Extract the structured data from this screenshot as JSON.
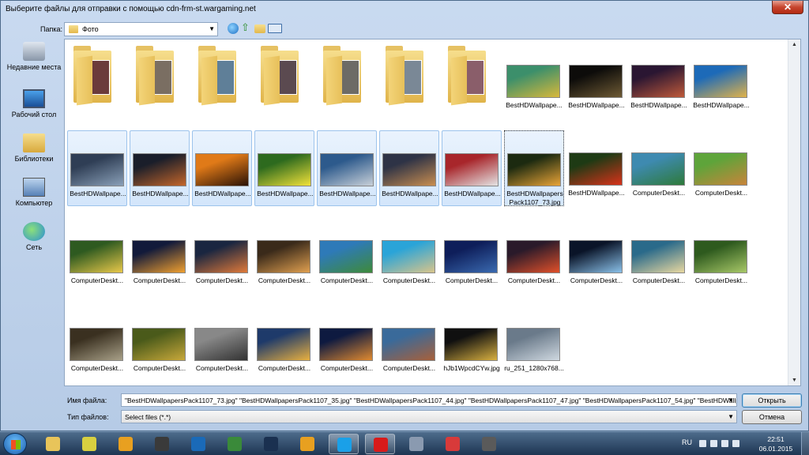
{
  "window": {
    "title": "Выберите файлы для отправки с помощью cdn-frm-st.wargaming.net",
    "close_label": "✕"
  },
  "toolbar": {
    "folder_label": "Папка:",
    "folder_value": "Фото"
  },
  "places": [
    {
      "label": "Недавние места",
      "icon": "recent-places-icon"
    },
    {
      "label": "Рабочий стол",
      "icon": "desktop-icon"
    },
    {
      "label": "Библиотеки",
      "icon": "libraries-icon"
    },
    {
      "label": "Компьютер",
      "icon": "computer-icon"
    },
    {
      "label": "Сеть",
      "icon": "network-icon"
    }
  ],
  "folders": [
    {
      "thumb_color": "#6b3b3b"
    },
    {
      "thumb_color": "#7a6e62"
    },
    {
      "thumb_color": "#5f7f98"
    },
    {
      "thumb_color": "#5b4a50"
    },
    {
      "thumb_color": "#6d6b66"
    },
    {
      "thumb_color": "#7a8896"
    },
    {
      "thumb_color": "#8a5e6a"
    }
  ],
  "files": [
    {
      "name": "BestHDWallpape...",
      "colors": [
        "#3c8f6b",
        "#d8b83b"
      ],
      "selected": false
    },
    {
      "name": "BestHDWallpape...",
      "colors": [
        "#0d0c0a",
        "#6e5a34"
      ],
      "selected": false
    },
    {
      "name": "BestHDWallpape...",
      "colors": [
        "#2a1632",
        "#c05a3a"
      ],
      "selected": false
    },
    {
      "name": "BestHDWallpape...",
      "colors": [
        "#1d6ab8",
        "#e0b24a"
      ],
      "selected": false
    },
    {
      "name": "BestHDWallpape...",
      "colors": [
        "#2f3e55",
        "#8aa0b8"
      ],
      "selected": true
    },
    {
      "name": "BestHDWallpape...",
      "colors": [
        "#1a1e2a",
        "#c4662a"
      ],
      "selected": true
    },
    {
      "name": "BestHDWallpape...",
      "colors": [
        "#e07a18",
        "#2a1206"
      ],
      "selected": true
    },
    {
      "name": "BestHDWallpape...",
      "colors": [
        "#2d6a1e",
        "#f2e23a"
      ],
      "selected": true
    },
    {
      "name": "BestHDWallpape...",
      "colors": [
        "#2d5a8c",
        "#c8d0d8"
      ],
      "selected": true
    },
    {
      "name": "BestHDWallpape...",
      "colors": [
        "#2e3346",
        "#c98e50"
      ],
      "selected": true
    },
    {
      "name": "BestHDWallpape...",
      "colors": [
        "#a8262b",
        "#e4e4e4"
      ],
      "selected": true
    },
    {
      "name": "BestHDWallpapersPack1107_73.jpg",
      "colors": [
        "#1c2a10",
        "#e9a437"
      ],
      "selected": true,
      "focus": true
    },
    {
      "name": "BestHDWallpape...",
      "colors": [
        "#1e3a14",
        "#d8321a"
      ],
      "selected": false
    },
    {
      "name": "ComputerDeskt...",
      "colors": [
        "#3e8ab0",
        "#2e7a3a"
      ],
      "selected": false
    },
    {
      "name": "ComputerDeskt...",
      "colors": [
        "#5ea43a",
        "#c8843a"
      ],
      "selected": false
    },
    {
      "name": "ComputerDeskt...",
      "colors": [
        "#2e5a20",
        "#e8c84a"
      ],
      "selected": false
    },
    {
      "name": "ComputerDeskt...",
      "colors": [
        "#121a3a",
        "#f0a030"
      ],
      "selected": false
    },
    {
      "name": "ComputerDeskt...",
      "colors": [
        "#1a2640",
        "#e07a3a"
      ],
      "selected": false
    },
    {
      "name": "ComputerDeskt...",
      "colors": [
        "#3a2a1a",
        "#e0a050"
      ],
      "selected": false
    },
    {
      "name": "ComputerDeskt...",
      "colors": [
        "#2e7ab8",
        "#3e8a3a"
      ],
      "selected": false
    },
    {
      "name": "ComputerDeskt...",
      "colors": [
        "#2aa4d8",
        "#d8c48a"
      ],
      "selected": false
    },
    {
      "name": "ComputerDeskt...",
      "colors": [
        "#0e1e5a",
        "#3a6ab0"
      ],
      "selected": false
    },
    {
      "name": "ComputerDeskt...",
      "colors": [
        "#2a1a2a",
        "#e0502a"
      ],
      "selected": false
    },
    {
      "name": "ComputerDeskt...",
      "colors": [
        "#0a1428",
        "#8ac0e8"
      ],
      "selected": false
    },
    {
      "name": "ComputerDeskt...",
      "colors": [
        "#2a6a8a",
        "#e8d8a0"
      ],
      "selected": false
    },
    {
      "name": "ComputerDeskt...",
      "colors": [
        "#2e5a1e",
        "#a8c868"
      ],
      "selected": false
    },
    {
      "name": "ComputerDeskt...",
      "colors": [
        "#3a3020",
        "#a8a088"
      ],
      "selected": false
    },
    {
      "name": "ComputerDeskt...",
      "colors": [
        "#4a5a1a",
        "#c8a83a"
      ],
      "selected": false
    },
    {
      "name": "ComputerDeskt...",
      "colors": [
        "#888888",
        "#333333"
      ],
      "selected": false
    },
    {
      "name": "ComputerDeskt...",
      "colors": [
        "#1e3a6a",
        "#e8b040"
      ],
      "selected": false
    },
    {
      "name": "ComputerDeskt...",
      "colors": [
        "#0e1a40",
        "#e08a30"
      ],
      "selected": false
    },
    {
      "name": "ComputerDeskt...",
      "colors": [
        "#3a6a9a",
        "#a8603a"
      ],
      "selected": false
    },
    {
      "name": "hJb1WpcdCYw.jpg",
      "colors": [
        "#101010",
        "#d8b040"
      ],
      "selected": false
    },
    {
      "name": "ru_251_1280x768...",
      "colors": [
        "#6a7a8a",
        "#cfd8e0"
      ],
      "selected": false
    }
  ],
  "footer": {
    "filename_label": "Имя файла:",
    "filename_value": "\"BestHDWallpapersPack1107_73.jpg\" \"BestHDWallpapersPack1107_35.jpg\" \"BestHDWallpapersPack1107_44.jpg\" \"BestHDWallpapersPack1107_47.jpg\" \"BestHDWallpapersPack1107_54.jpg\" \"BestHDWallpape",
    "filetype_label": "Тип файлов:",
    "filetype_value": "Select files (*.*)",
    "open_label": "Открыть",
    "cancel_label": "Отмена"
  },
  "taskbar": {
    "apps": [
      {
        "name": "explorer-folder",
        "color": "#e8c45a",
        "active": false
      },
      {
        "name": "paint-app",
        "color": "#d8d040",
        "active": false
      },
      {
        "name": "keys-app",
        "color": "#e8a020",
        "active": false
      },
      {
        "name": "monitor-app",
        "color": "#3a3a3a",
        "active": false
      },
      {
        "name": "nero-app",
        "color": "#1a6ab8",
        "active": false
      },
      {
        "name": "notepad-app",
        "color": "#3a8a3a",
        "active": false
      },
      {
        "name": "steam-app",
        "color": "#1a3050",
        "active": false
      },
      {
        "name": "aimp-app",
        "color": "#e8a020",
        "active": false
      },
      {
        "name": "skype-app",
        "color": "#1aa0e8",
        "active": true
      },
      {
        "name": "opera-app",
        "color": "#d81a1a",
        "active": true
      },
      {
        "name": "media-app",
        "color": "#8a9ab0",
        "active": false
      },
      {
        "name": "punto-app",
        "color": "#d83a3a",
        "active": false
      },
      {
        "name": "wot-app",
        "color": "#5a5a5a",
        "active": false
      }
    ],
    "lang": "RU",
    "time": "22:51",
    "date": "06.01.2015"
  }
}
